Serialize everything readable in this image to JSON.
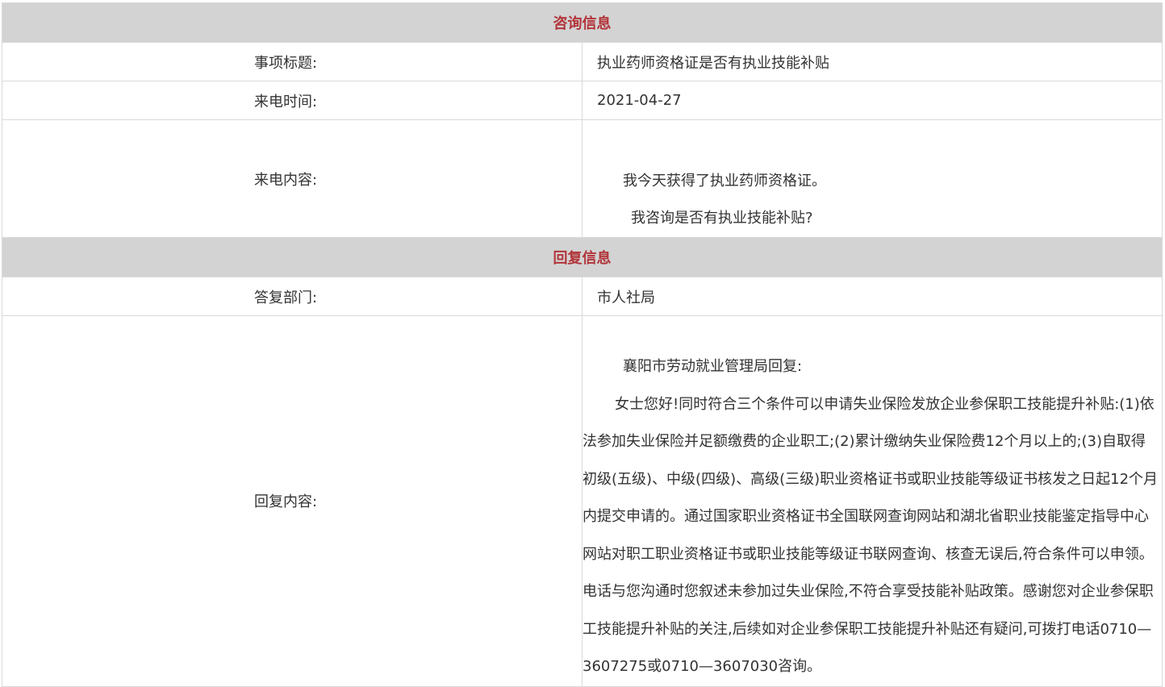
{
  "consult": {
    "section_title": "咨询信息",
    "title_label": "事项标题:",
    "title_value": "执业药师资格证是否有执业技能补贴",
    "date_label": "来电时间:",
    "date_value": "2021-04-27",
    "content_label": "来电内容:",
    "content_line1": "我今天获得了执业药师资格证。",
    "content_line2": "我咨询是否有执业技能补贴?"
  },
  "reply": {
    "section_title": "回复信息",
    "dept_label": "答复部门:",
    "dept_value": "市人社局",
    "content_label": "回复内容:",
    "para1": "襄阳市劳动就业管理局回复:",
    "para2": "女士您好!同时符合三个条件可以申请失业保险发放企业参保职工技能提升补贴:(1)依法参加失业保险并足额缴费的企业职工;(2)累计缴纳失业保险费12个月以上的;(3)自取得初级(五级)、中级(四级)、高级(三级)职业资格证书或职业技能等级证书核发之日起12个月内提交申请的。通过国家职业资格证书全国联网查询网站和湖北省职业技能鉴定指导中心网站对职工职业资格证书或职业技能等级证书联网查询、核查无误后,符合条件可以申领。电话与您沟通时您叙述未参加过失业保险,不符合享受技能补贴政策。感谢您对企业参保职工技能提升补贴的关注,后续如对企业参保职工技能提升补贴还有疑问,可拨打电话0710—3607275或0710—3607030咨询。"
  }
}
